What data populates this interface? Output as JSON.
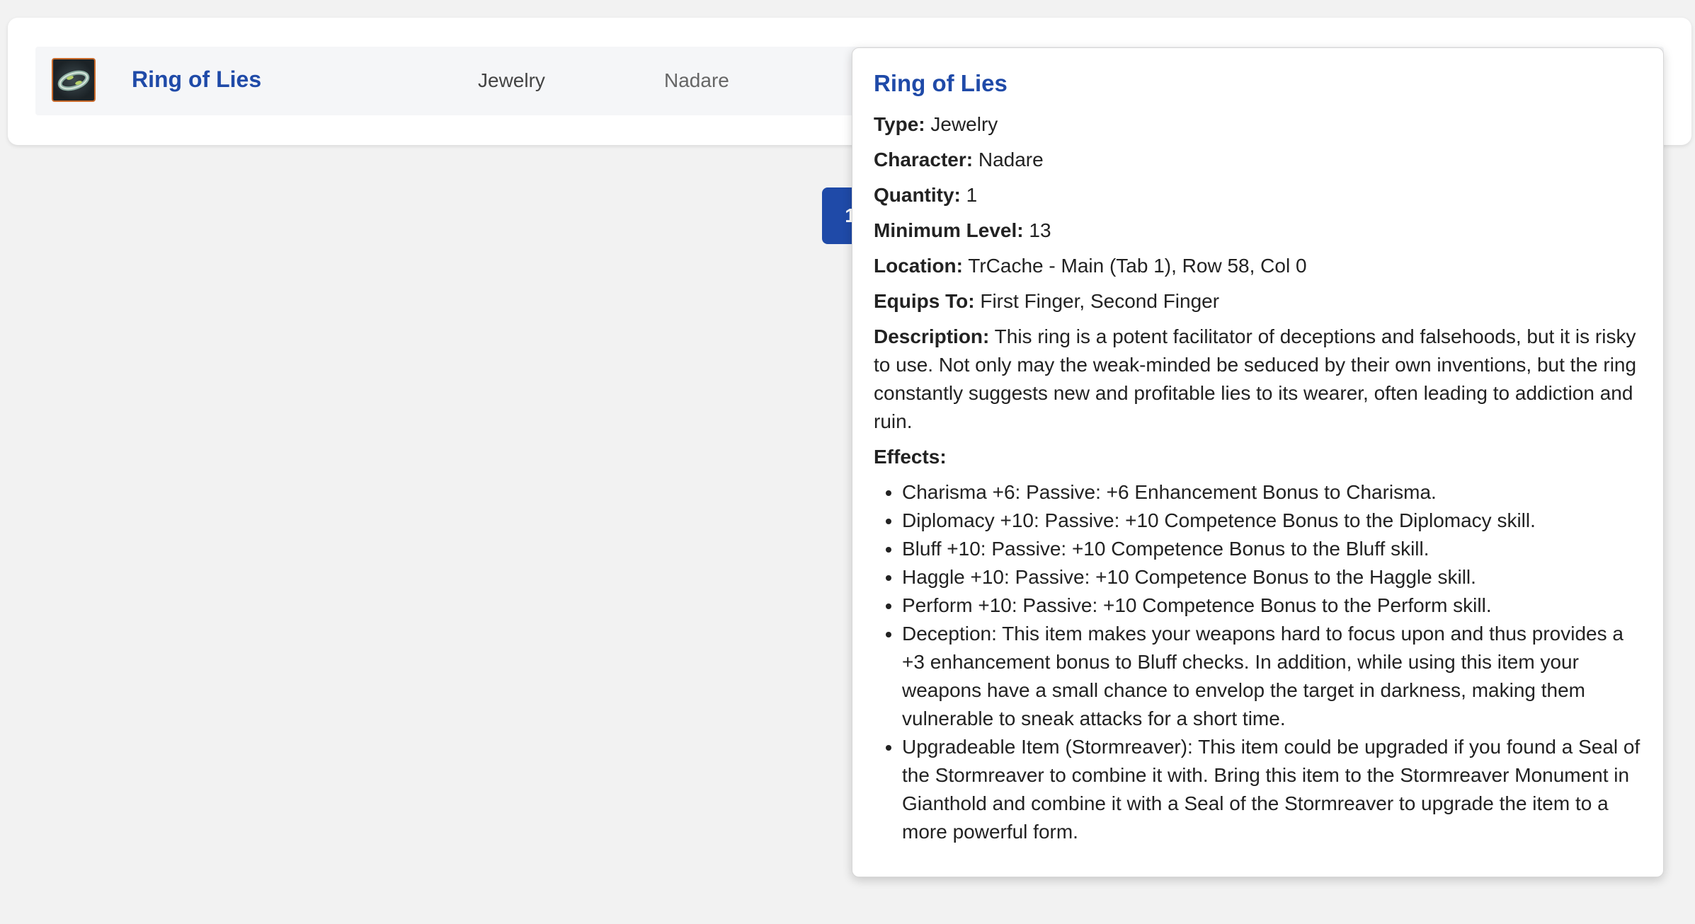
{
  "item_row": {
    "name": "Ring of Lies",
    "type": "Jewelry",
    "character": "Nadare",
    "icon": "ring-icon"
  },
  "pagination": {
    "current_page": "1"
  },
  "tooltip": {
    "title": "Ring of Lies",
    "fields": [
      {
        "label": "Type:",
        "value": "Jewelry"
      },
      {
        "label": "Character:",
        "value": "Nadare"
      },
      {
        "label": "Quantity:",
        "value": "1"
      },
      {
        "label": "Minimum Level:",
        "value": "13"
      },
      {
        "label": "Location:",
        "value": "TrCache - Main (Tab 1), Row 58, Col 0"
      },
      {
        "label": "Equips To:",
        "value": "First Finger, Second Finger"
      }
    ],
    "description_label": "Description:",
    "description": "This ring is a potent facilitator of deceptions and falsehoods, but it is risky to use. Not only may the weak-minded be seduced by their own inventions, but the ring constantly suggests new and profitable lies to its wearer, often leading to addiction and ruin.",
    "effects_label": "Effects:",
    "effects": [
      "Charisma +6: Passive: +6 Enhancement Bonus to Charisma.",
      "Diplomacy +10: Passive: +10 Competence Bonus to the Diplomacy skill.",
      "Bluff +10: Passive: +10 Competence Bonus to the Bluff skill.",
      "Haggle +10: Passive: +10 Competence Bonus to the Haggle skill.",
      "Perform +10: Passive: +10 Competence Bonus to the Perform skill.",
      "Deception: This item makes your weapons hard to focus upon and thus provides a +3 enhancement bonus to Bluff checks. In addition, while using this item your weapons have a small chance to envelop the target in darkness, making them vulnerable to sneak attacks for a short time.",
      "Upgradeable Item (Stormreaver): This item could be upgraded if you found a Seal of the Stormreaver to combine it with. Bring this item to the Stormreaver Monument in Gianthold and combine it with a Seal of the Stormreaver to upgrade the item to a more powerful form."
    ]
  },
  "colors": {
    "link": "#1f4aa8",
    "page_button": "#1f4aa8",
    "icon_border": "#c96a2b"
  }
}
